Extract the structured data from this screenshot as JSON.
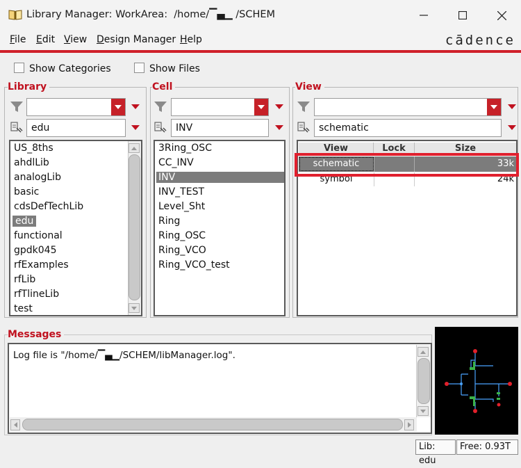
{
  "window": {
    "title": "Library Manager: WorkArea:  /home/▔▄▁ /SCHEM",
    "controls": [
      "minimize",
      "maximize",
      "close"
    ]
  },
  "menu": {
    "items": [
      {
        "first": "F",
        "rest": "ile"
      },
      {
        "first": "E",
        "rest": "dit"
      },
      {
        "first": "V",
        "rest": "iew"
      },
      {
        "first": "D",
        "rest": "esign Manager"
      },
      {
        "first": "H",
        "rest": "elp"
      }
    ],
    "brand": "cādence"
  },
  "options": {
    "show_categories": "Show Categories",
    "show_files": "Show Files"
  },
  "library": {
    "title": "Library",
    "filter_value": "edu",
    "items": [
      "US_8ths",
      "ahdlLib",
      "analogLib",
      "basic",
      "cdsDefTechLib",
      "edu",
      "functional",
      "gpdk045",
      "rfExamples",
      "rfLib",
      "rfTlineLib",
      "test"
    ],
    "selected": "edu"
  },
  "cell": {
    "title": "Cell",
    "filter_value": "INV",
    "items": [
      "3Ring_OSC",
      "CC_INV",
      "INV",
      "INV_TEST",
      "Level_Sht",
      "Ring",
      "Ring_OSC",
      "Ring_VCO",
      "Ring_VCO_test"
    ],
    "selected": "INV"
  },
  "view": {
    "title": "View",
    "filter_value": "schematic",
    "columns": [
      "View",
      "Lock",
      "Size"
    ],
    "rows": [
      {
        "view": "schematic",
        "lock": "",
        "size": "33k",
        "selected": true
      },
      {
        "view": "symbol",
        "lock": "",
        "size": "24k",
        "selected": false
      }
    ]
  },
  "messages": {
    "title": "Messages",
    "text": "Log file is \"/home/▔▄▁/SCHEM/libManager.log\"."
  },
  "status": {
    "lib": "Lib: edu",
    "free": "Free: 0.93T"
  },
  "colors": {
    "accent_red": "#c0111f",
    "selection_gray": "#7c7c7c",
    "highlight_box": "#e0202e"
  }
}
